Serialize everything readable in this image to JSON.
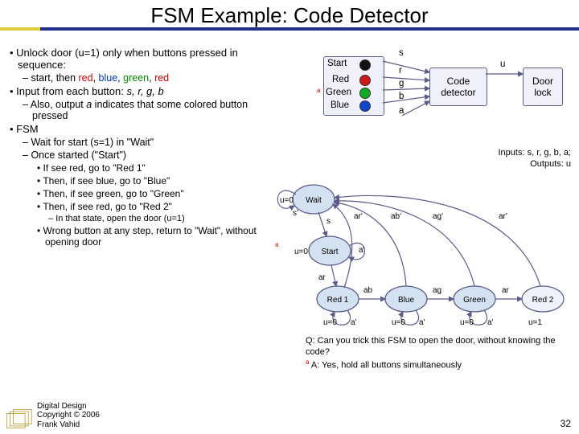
{
  "title": "FSM Example: Code Detector",
  "left": {
    "p1": "Unlock door (u=1) only when buttons pressed in sequence:",
    "p1a_a": "start, then ",
    "p1a_r": "red",
    "p1a_sep": ", ",
    "p1a_b": "blue",
    "p1a_g": "green",
    "p1a_r2": "red",
    "p2_left": "Input from each button: ",
    "p2_em": "s, r, g, b",
    "p2a_a": "Also, output ",
    "p2a_em": "a",
    "p2a_b": " indicates that some colored button pressed",
    "p3": "FSM",
    "p3a": "Wait for start (s=1) in \"Wait\"",
    "p3b": "Once started (\"Start\")",
    "p3b1": "If see red, go to \"Red 1\"",
    "p3b2": "Then, if see blue, go to \"Blue\"",
    "p3b3": "Then, if see green, go to \"Green\"",
    "p3b4": "Then, if see red, go to \"Red 2\"",
    "p3b4a": "In that state, open the door (u=1)",
    "p3c": "Wrong button at any step, return to \"Wait\", without opening door"
  },
  "io": {
    "text": "Inputs: s, r, g, b, a;\nOutputs: u"
  },
  "bb": {
    "start": "Start",
    "red": "Red",
    "green": "Green",
    "blue": "Blue",
    "s": "s",
    "r": "r",
    "g": "g",
    "b": "b",
    "a": "a",
    "u": "u",
    "code": "Code\ndetector",
    "door": "Door\nlock",
    "amark": "a"
  },
  "fsm": {
    "wait": "Wait",
    "start": "Start",
    "red1": "Red 1",
    "blue": "Blue",
    "green": "Green",
    "red2": "Red 2",
    "u0": "u=0",
    "u1": "u=1",
    "sp": "s'",
    "s": "s",
    "ap": "a'",
    "arp": "ar'",
    "abp": "ab'",
    "agp": "ag'",
    "ar": "ar",
    "ab": "ab",
    "ag": "ag",
    "amark": "a"
  },
  "q": {
    "q": "Q: Can you trick this FSM to open the door, without knowing the code?",
    "amark": "a",
    "ans": "A: Yes, hold all buttons simultaneously"
  },
  "footer": {
    "l1": "Digital Design",
    "l2": "Copyright © 2006",
    "l3": "Frank Vahid"
  },
  "pagenum": "32"
}
